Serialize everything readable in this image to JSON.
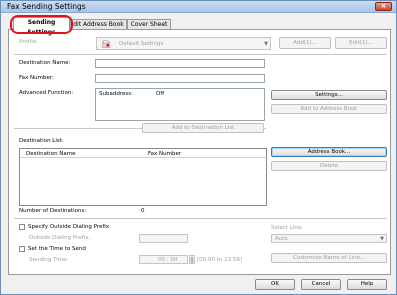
{
  "window": {
    "title": "Fax Sending Settings",
    "close_icon": "×"
  },
  "tabs": [
    {
      "label": "Sending Settings"
    },
    {
      "label": "dit Address Book"
    },
    {
      "label": "Cover Sheet"
    }
  ],
  "profile": {
    "label": "Profile:",
    "value": "Default Settings",
    "add_label": "Add(1)...",
    "edit_label": "Edit(1)..."
  },
  "destination": {
    "name_label": "Destination Name:",
    "number_label": "Fax Number:",
    "advanced_label": "Advanced Function:",
    "subaddress_label": "Subaddress:",
    "subaddress_value": "Off",
    "settings_label": "Settings...",
    "add_to_address_book": "Add to Address Book",
    "add_to_list": "Add to Destination List"
  },
  "destination_list": {
    "label": "Destination List:",
    "col_name": "Destination Name",
    "col_fax": "Fax Number",
    "address_book": "Address Book...",
    "delete": "Delete",
    "count_label": "Number of Destinations:",
    "count_value": "0"
  },
  "options": {
    "prefix_label": "Specify Outside Dialing Prefix",
    "prefix_sub": "Outside Dialing Prefix:",
    "time_label": "Set the Time to Send",
    "time_sub": "Sending Time:",
    "time_value": "00 : 00",
    "time_range": "[00:00 to 23:59]",
    "select_line_label": "Select Line:",
    "select_line_value": "Auto",
    "customize_line": "Customize Name of Line..."
  },
  "footer": {
    "ok": "OK",
    "cancel": "Cancel",
    "help": "Help"
  }
}
